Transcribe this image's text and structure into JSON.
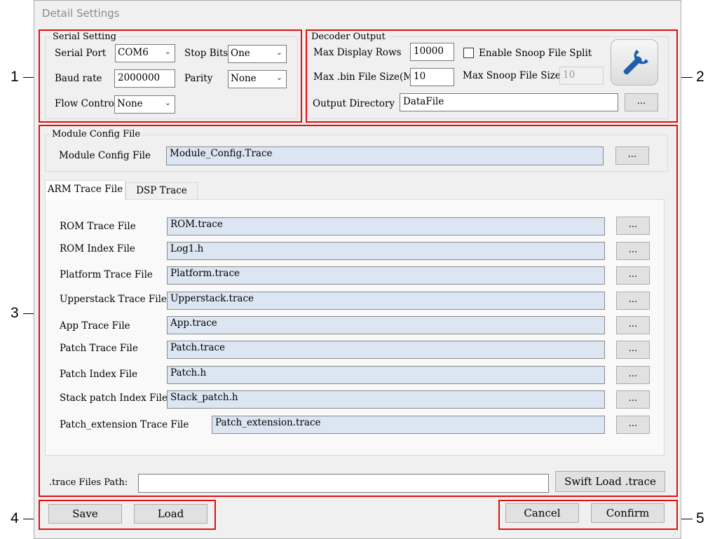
{
  "window": {
    "title": "Detail Settings"
  },
  "callouts": [
    "1",
    "2",
    "3",
    "4",
    "5"
  ],
  "serial": {
    "group_label": "Serial Setting",
    "port_label": "Serial Port",
    "port_value": "COM6",
    "stopbits_label": "Stop Bits",
    "stopbits_value": "One",
    "baud_label": "Baud rate",
    "baud_value": "2000000",
    "parity_label": "Parity",
    "parity_value": "None",
    "flow_label": "Flow Control",
    "flow_value": "None"
  },
  "decoder": {
    "group_label": "Decoder Output",
    "rows_label": "Max Display Rows",
    "rows_value": "10000",
    "split_label": "Enable Snoop File Split",
    "split_checked": false,
    "binsize_label": "Max .bin File Size(M)",
    "binsize_value": "10",
    "snoop_label": "Max Snoop File Size",
    "snoop_value": "10",
    "outdir_label": "Output Directory",
    "outdir_value": "DataFile",
    "browse_label": "..."
  },
  "module": {
    "group_label": "Module Config File",
    "file_label": "Module Config File",
    "file_value": "Module_Config.Trace",
    "browse_label": "..."
  },
  "tabs": [
    {
      "label": "ARM Trace File",
      "active": true
    },
    {
      "label": "DSP Trace File",
      "active": false
    }
  ],
  "trace_files": [
    {
      "label": "ROM Trace File",
      "value": "ROM.trace"
    },
    {
      "label": "ROM Index File",
      "value": "Log1.h"
    },
    {
      "label": "Platform Trace File",
      "value": "Platform.trace"
    },
    {
      "label": "Upperstack Trace File",
      "value": "Upperstack.trace"
    },
    {
      "label": "App Trace File",
      "value": "App.trace"
    },
    {
      "label": "Patch Trace File",
      "value": "Patch.trace"
    },
    {
      "label": "Patch Index File",
      "value": "Patch.h"
    },
    {
      "label": "Stack patch Index File",
      "value": "Stack_patch.h"
    },
    {
      "label": "Patch_extension Trace File",
      "value": "Patch_extension.trace"
    }
  ],
  "browse_label": "...",
  "path": {
    "label": ".trace Files Path:",
    "value": "",
    "swift_label": "Swift Load .trace"
  },
  "footer": {
    "save": "Save",
    "load": "Load",
    "cancel": "Cancel",
    "confirm": "Confirm"
  },
  "colors": {
    "highlight": "#e01010",
    "field_fill": "#dce6f2",
    "window_bg": "#f0f0f0"
  }
}
